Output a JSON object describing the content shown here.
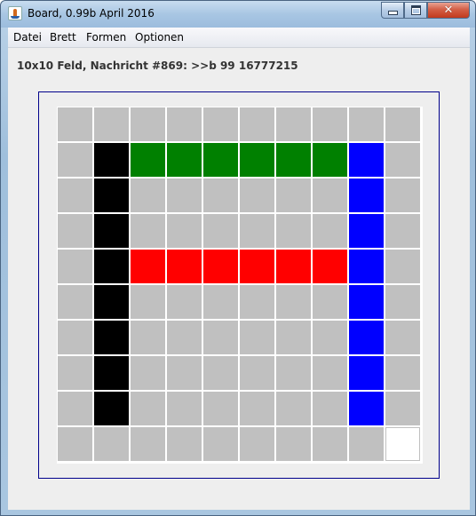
{
  "window": {
    "title": "Board, 0.99b April 2016",
    "icon": "java-icon"
  },
  "menu": {
    "items": [
      "Datei",
      "Brett",
      "Formen",
      "Optionen"
    ]
  },
  "message": "10x10 Feld, Nachricht #869: >>b 99 16777215",
  "board": {
    "columns": 10,
    "rows": 10,
    "palette": {
      "empty": "#c0c0c0",
      "black": "#000000",
      "green": "#008000",
      "blue": "#0000ff",
      "red": "#ff0000",
      "white": "#ffffff"
    },
    "cells": [
      [
        "empty",
        "empty",
        "empty",
        "empty",
        "empty",
        "empty",
        "empty",
        "empty",
        "empty",
        "empty"
      ],
      [
        "empty",
        "black",
        "green",
        "green",
        "green",
        "green",
        "green",
        "green",
        "blue",
        "empty"
      ],
      [
        "empty",
        "black",
        "empty",
        "empty",
        "empty",
        "empty",
        "empty",
        "empty",
        "blue",
        "empty"
      ],
      [
        "empty",
        "black",
        "empty",
        "empty",
        "empty",
        "empty",
        "empty",
        "empty",
        "blue",
        "empty"
      ],
      [
        "empty",
        "black",
        "red",
        "red",
        "red",
        "red",
        "red",
        "red",
        "blue",
        "empty"
      ],
      [
        "empty",
        "black",
        "empty",
        "empty",
        "empty",
        "empty",
        "empty",
        "empty",
        "blue",
        "empty"
      ],
      [
        "empty",
        "black",
        "empty",
        "empty",
        "empty",
        "empty",
        "empty",
        "empty",
        "blue",
        "empty"
      ],
      [
        "empty",
        "black",
        "empty",
        "empty",
        "empty",
        "empty",
        "empty",
        "empty",
        "blue",
        "empty"
      ],
      [
        "empty",
        "black",
        "empty",
        "empty",
        "empty",
        "empty",
        "empty",
        "empty",
        "blue",
        "empty"
      ],
      [
        "empty",
        "empty",
        "empty",
        "empty",
        "empty",
        "empty",
        "empty",
        "empty",
        "empty",
        "white"
      ]
    ]
  }
}
